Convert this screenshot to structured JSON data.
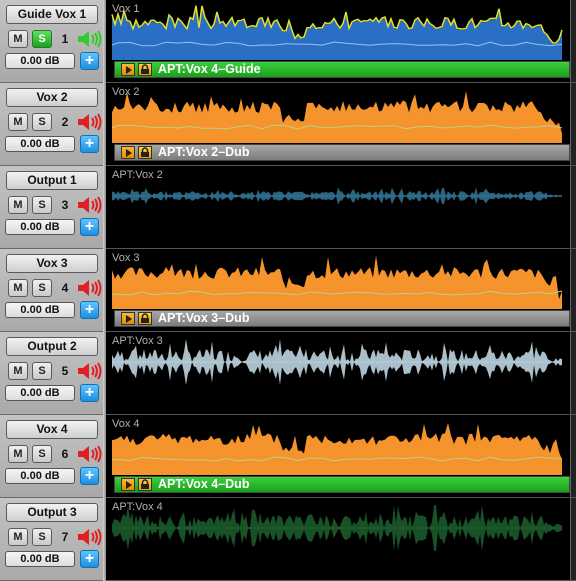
{
  "tracks": [
    {
      "name": "Guide Vox 1",
      "mute": "M",
      "solo": "S",
      "solo_on": true,
      "number": "1",
      "speaker": "green",
      "volume": "0.00 dB",
      "add": "+",
      "lane_label": "Vox 1",
      "wave": "blue",
      "bar": {
        "text": "APT:Vox 4–Guide",
        "color": "green"
      }
    },
    {
      "name": "Vox 2",
      "mute": "M",
      "solo": "S",
      "solo_on": false,
      "number": "2",
      "speaker": "red",
      "volume": "0.00 dB",
      "add": "+",
      "lane_label": "Vox 2",
      "wave": "orange",
      "bar": {
        "text": "APT:Vox 2–Dub",
        "color": "grey"
      }
    },
    {
      "name": "Output 1",
      "mute": "M",
      "solo": "S",
      "solo_on": false,
      "number": "3",
      "speaker": "red",
      "volume": "0.00 dB",
      "add": "+",
      "lane_label": "APT:Vox 2",
      "wave": "thin-blue",
      "bar": null
    },
    {
      "name": "Vox 3",
      "mute": "M",
      "solo": "S",
      "solo_on": false,
      "number": "4",
      "speaker": "red",
      "volume": "0.00 dB",
      "add": "+",
      "lane_label": "Vox 3",
      "wave": "orange",
      "bar": {
        "text": "APT:Vox 3–Dub",
        "color": "grey"
      }
    },
    {
      "name": "Output 2",
      "mute": "M",
      "solo": "S",
      "solo_on": false,
      "number": "5",
      "speaker": "red",
      "volume": "0.00 dB",
      "add": "+",
      "lane_label": "APT:Vox 3",
      "wave": "white-blue",
      "bar": null
    },
    {
      "name": "Vox 4",
      "mute": "M",
      "solo": "S",
      "solo_on": false,
      "number": "6",
      "speaker": "red",
      "volume": "0.00 dB",
      "add": "+",
      "lane_label": "Vox 4",
      "wave": "orange",
      "bar": {
        "text": "APT:Vox 4–Dub",
        "color": "green"
      }
    },
    {
      "name": "Output 3",
      "mute": "M",
      "solo": "S",
      "solo_on": false,
      "number": "7",
      "speaker": "red",
      "volume": "0.00 dB",
      "add": "+",
      "lane_label": "APT:Vox 4",
      "wave": "dark-green",
      "bar": null
    }
  ],
  "colors": {
    "wave_blue": "#2b6fc4",
    "wave_blue_top": "#e3e22a",
    "wave_orange": "#f5932c",
    "wave_thin_blue": "#2e6f8e",
    "wave_white_blue": "#bcd4e0",
    "wave_dark_green": "#1b5a2a",
    "speaker_green": "#2ecc2e",
    "speaker_red": "#e02020",
    "bar_green": "#22b022",
    "bar_grey": "#8c8c8c"
  }
}
